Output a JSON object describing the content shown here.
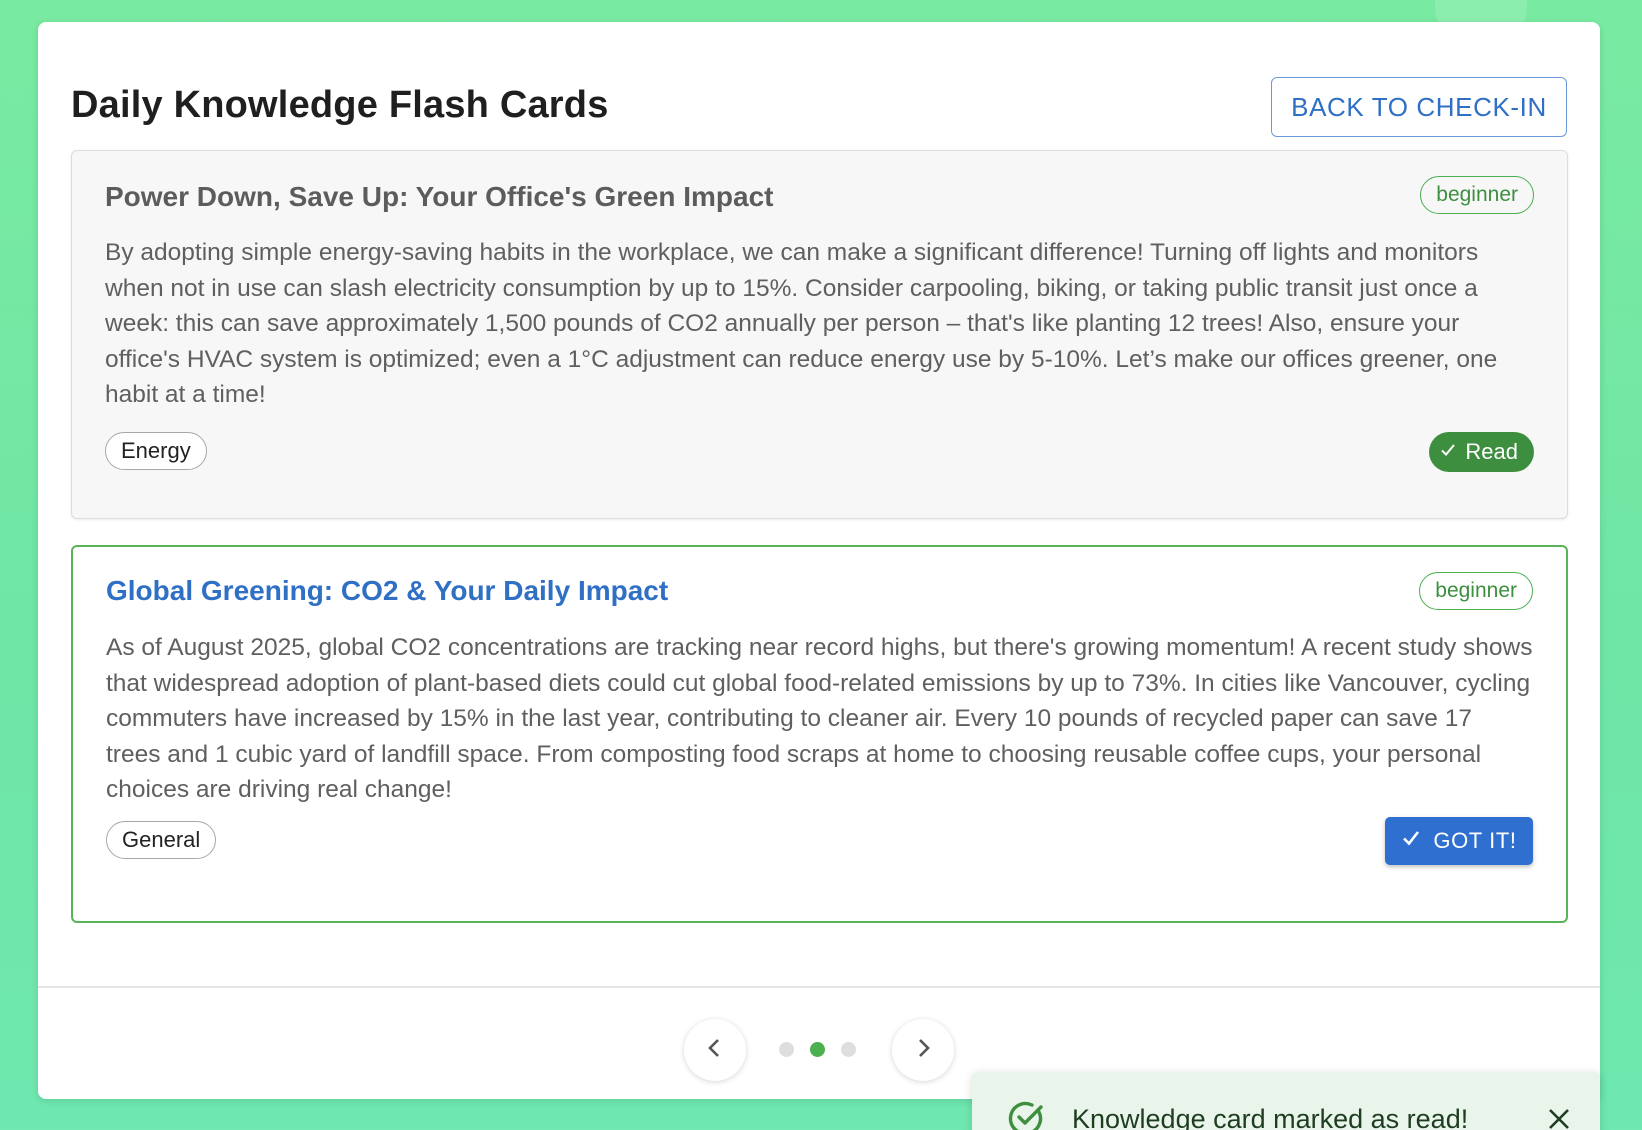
{
  "page": {
    "title": "Daily Knowledge Flash Cards",
    "back_button_label": "BACK TO CHECK-IN"
  },
  "cards": [
    {
      "title": "Power Down, Save Up: Your Office's Green Impact",
      "level": "beginner",
      "body": "By adopting simple energy-saving habits in the workplace, we can make a significant difference! Turning off lights and monitors when not in use can slash electricity consumption by up to 15%. Consider carpooling, biking, or taking public transit just once a week: this can save approximately 1,500 pounds of CO2 annually per person – that's like planting 12 trees! Also, ensure your office's HVAC system is optimized; even a 1°C adjustment can reduce energy use by 5-10%. Let’s make our offices greener, one habit at a time!",
      "topic": "Energy",
      "status_label": "Read"
    },
    {
      "title": "Global Greening: CO2 & Your Daily Impact",
      "level": "beginner",
      "body": "As of August 2025, global CO2 concentrations are tracking near record highs, but there's growing momentum! A recent study shows that widespread adoption of plant-based diets could cut global food-related emissions by up to 73%. In cities like Vancouver, cycling commuters have increased by 15% in the last year, contributing to cleaner air. Every 10 pounds of recycled paper can save 17 trees and 1 cubic yard of landfill space. From composting food scraps at home to choosing reusable coffee cups, your personal choices are driving real change!",
      "topic": "General",
      "action_label": "GOT IT!"
    }
  ],
  "pagination": {
    "total_pages": 3,
    "current_page": 2
  },
  "toast": {
    "message": "Knowledge card marked as read!"
  },
  "icons": {
    "prev": "chevron-left-icon",
    "next": "chevron-right-icon",
    "check": "checkmark-icon",
    "toast": "check-circle-icon",
    "close": "close-icon"
  },
  "colors": {
    "background": "#79eaa1",
    "primary_blue": "#2f6fc4",
    "success_green": "#3e8e3f",
    "active_border": "#58b45a"
  }
}
